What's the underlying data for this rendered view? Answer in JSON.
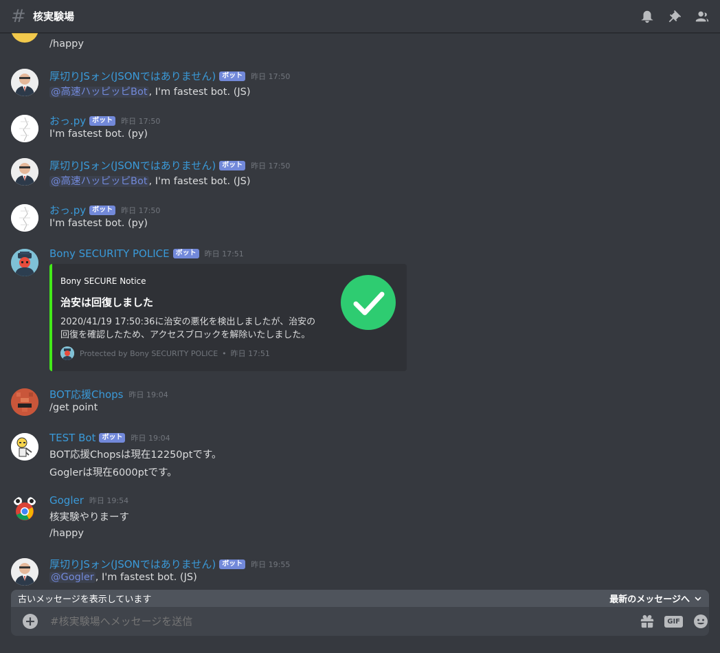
{
  "header": {
    "hash": "#",
    "channel": "核実験場",
    "icons": [
      "bell-icon",
      "pin-icon",
      "members-icon"
    ]
  },
  "messages": [
    {
      "kind": "continuation",
      "lines": [
        "/happy"
      ]
    },
    {
      "user": "厚切りJSォン(JSONではありません)",
      "bot": "ボット",
      "time": "昨日 17:50",
      "mention": "@高速ハッピッピBot",
      "text": ", I'm fastest bot. (JS)"
    },
    {
      "user": "おっ.py",
      "bot": "ボット",
      "time": "昨日 17:50",
      "text": "I'm fastest bot. (py)"
    },
    {
      "user": "厚切りJSォン(JSONではありません)",
      "bot": "ボット",
      "time": "昨日 17:50",
      "mention": "@高速ハッピッピBot",
      "text": ", I'm fastest bot. (JS)"
    },
    {
      "user": "おっ.py",
      "bot": "ボット",
      "time": "昨日 17:50",
      "text": "I'm fastest bot. (py)"
    },
    {
      "user": "Bony SECURITY POLICE",
      "bot": "ボット",
      "time": "昨日 17:51",
      "embed": {
        "author": "Bony SECURE Notice",
        "title": "治安は回復しました",
        "desc_line1": "2020/41/19 17:50:36に治安の悪化を検出しましたが、治安の",
        "desc_line2": "回復を確認したため、アクセスブロックを解除いたしました。",
        "footer": "Protected by Bony SECURITY POLICE",
        "sep": "•",
        "footer_time": "昨日 17:51",
        "color": "#43ea19",
        "thumb_color": "#2ecc71"
      }
    },
    {
      "user": "BOT応援Chops",
      "time": "昨日 19:04",
      "text": "/get point"
    },
    {
      "user": "TEST Bot",
      "bot": "ボット",
      "time": "昨日 19:04",
      "text": "BOT応援Chopsは現在12250ptです。",
      "text2": "Goglerは現在6000ptです。"
    },
    {
      "user": "Gogler",
      "time": "昨日 19:54",
      "text": "核実験やりまーす",
      "text2": "/happy"
    },
    {
      "user": "厚切りJSォン(JSONではありません)",
      "bot": "ボット",
      "time": "昨日 19:55",
      "mention": "@Gogler",
      "text": ", I'm fastest bot. (JS)"
    }
  ],
  "old_messages_bar": {
    "text": "古いメッセージを表示しています",
    "jump": "最新のメッセージへ"
  },
  "composer": {
    "placeholder": "#核実験場へメッセージを送信",
    "gif": "GIF",
    "icons": [
      "add-icon",
      "gift-icon",
      "gif-icon",
      "emoji-icon"
    ]
  },
  "colors": {
    "background": "#36393f",
    "username": "#3a9ad9",
    "bot_tag": "#7289da",
    "mention": "#7289da"
  }
}
